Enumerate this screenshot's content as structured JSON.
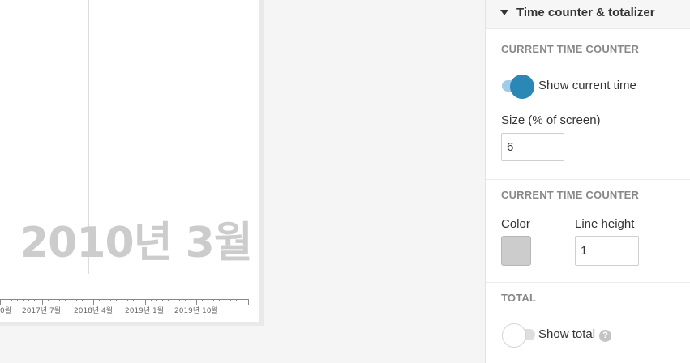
{
  "preview": {
    "current_time_label": "2010년 3월",
    "axis_ticks": [
      "0월",
      "2017년 7월",
      "2018년 4월",
      "2019년 1월",
      "2019년 10월"
    ]
  },
  "panel": {
    "title": "Time counter & totalizer",
    "section1": {
      "title": "CURRENT TIME COUNTER",
      "toggle_label": "Show current time",
      "toggle_on": true,
      "size_label": "Size (% of screen)",
      "size_value": "6"
    },
    "section2": {
      "title": "CURRENT TIME COUNTER",
      "color_label": "Color",
      "color_value": "#cccccc",
      "line_height_label": "Line height",
      "line_height_value": "1"
    },
    "section3": {
      "title": "TOTAL",
      "toggle_label": "Show total",
      "toggle_on": false,
      "help_glyph": "?"
    }
  },
  "colors": {
    "accent": "#2b87b3",
    "accent_light": "#9fcce6",
    "date_text": "#cccccc"
  },
  "icons": [
    "caret-down-icon",
    "help-icon"
  ]
}
